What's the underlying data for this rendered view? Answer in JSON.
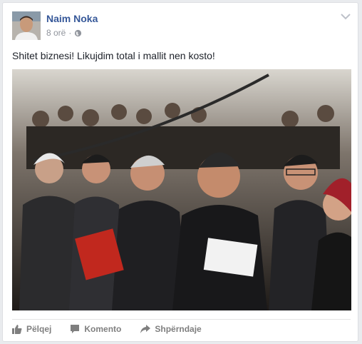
{
  "post": {
    "author": "Naim Noka",
    "time": "8 orë",
    "audience_icon": "globe-icon",
    "text": "Shitet biznesi! Likujdim total i mallit nen kosto!"
  },
  "actions": {
    "like_label": "Pëlqej",
    "comment_label": "Komento",
    "share_label": "Shpërndaje"
  },
  "colors": {
    "author_link": "#365899",
    "meta_text": "#90949c",
    "action_text": "#7f7f7f"
  }
}
